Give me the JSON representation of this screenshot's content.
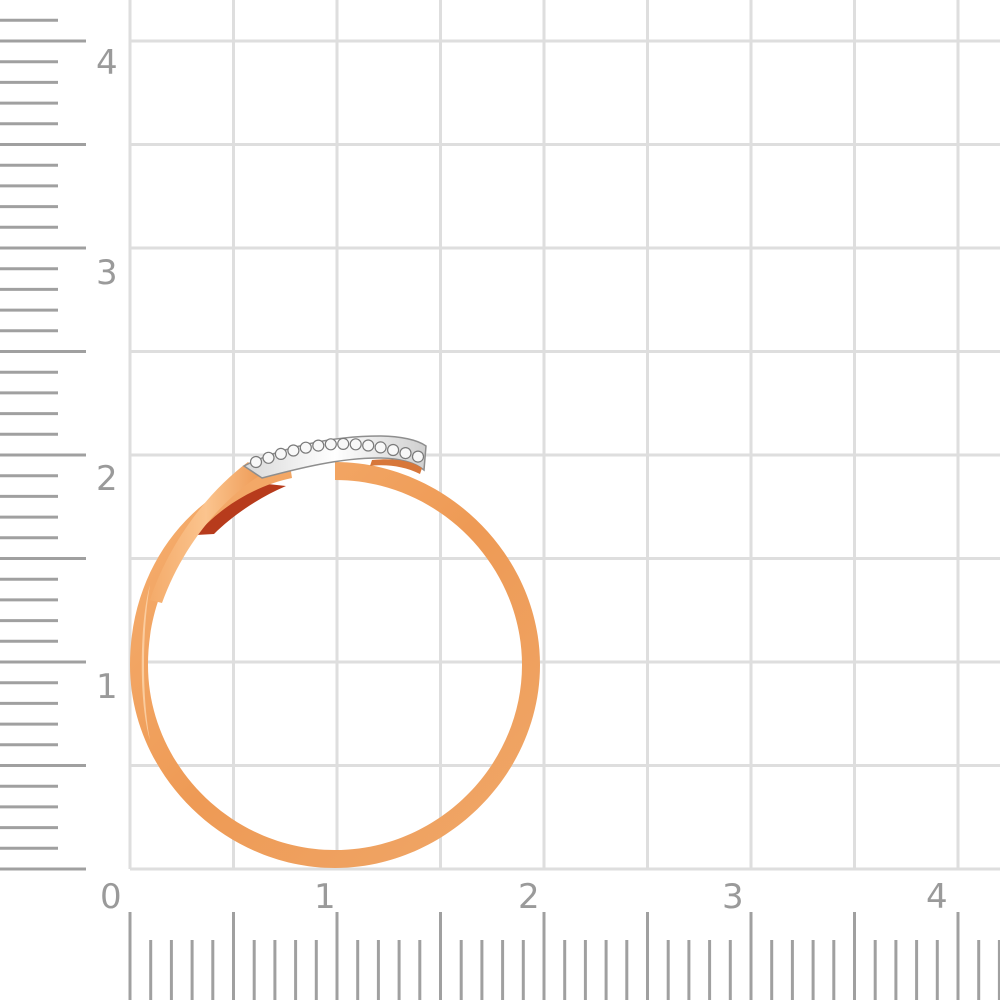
{
  "scale": {
    "unit_note": "",
    "x_ticks": [
      "0",
      "1",
      "2",
      "3",
      "4"
    ],
    "y_ticks": [
      "1",
      "2",
      "3",
      "4"
    ]
  },
  "colors": {
    "grid": "#dedede",
    "ruler": "#a0a0a0",
    "gold_light": "#f6b071",
    "gold_mid": "#ee9a55",
    "gold_dark": "#d7773a",
    "inner_shadow": "#b73b1c",
    "white_gold": "#eeeeee",
    "diamond_edge": "#8e8e8e"
  },
  "ring": {
    "material": "rose gold band with white-gold pavé crossover",
    "stone_count": 14
  }
}
